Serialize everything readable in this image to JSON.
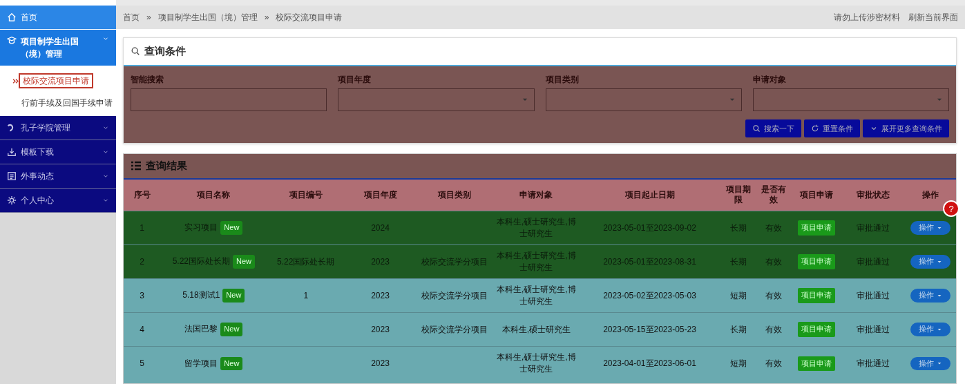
{
  "sidebar": {
    "items": [
      {
        "label": "首页",
        "selected": true
      },
      {
        "label": "项目制学生出国（境）管理",
        "selected": false,
        "expanded": true,
        "children": [
          {
            "label": "校际交流项目申请",
            "selected": true
          },
          {
            "label": "行前手续及回国手续申请",
            "selected": false
          }
        ]
      },
      {
        "label": "孔子学院管理",
        "selected": false,
        "expanded": false
      },
      {
        "label": "模板下载",
        "selected": false,
        "expanded": false
      },
      {
        "label": "外事动态",
        "selected": false,
        "expanded": false
      },
      {
        "label": "个人中心",
        "selected": false,
        "expanded": false
      }
    ]
  },
  "breadcrumb": {
    "items": [
      "首页",
      "项目制学生出国（境）管理",
      "校际交流项目申请"
    ],
    "separator": "»"
  },
  "header_links": [
    "请勿上传涉密材料",
    "刷新当前界面"
  ],
  "filters": {
    "title": "查询条件",
    "fields": [
      {
        "label": "智能搜索",
        "kind": "text"
      },
      {
        "label": "项目年度",
        "kind": "select"
      },
      {
        "label": "项目类别",
        "kind": "select"
      },
      {
        "label": "申请对象",
        "kind": "select"
      }
    ],
    "buttons": [
      {
        "label": "搜索一下",
        "kind": "search"
      },
      {
        "label": "重置条件",
        "kind": "reset"
      },
      {
        "label": "展开更多查询条件",
        "kind": "expand"
      }
    ]
  },
  "results": {
    "title": "查询结果",
    "columns": [
      "序号",
      "项目名称",
      "项目编号",
      "项目年度",
      "项目类别",
      "申请对象",
      "项目起止日期",
      "项目期限",
      "是否有效",
      "项目申请",
      "审批状态",
      "操作"
    ],
    "rows": [
      {
        "index": "1",
        "name": "实习项目",
        "badge": "New",
        "year": "2024",
        "target": "本科生,硕士研究生,博士研究生",
        "dates": "2023-05-01至2023-09-02",
        "term": "长期",
        "valid": "有效",
        "apply": "项目申请",
        "status": "审批通过",
        "action": "操作"
      },
      {
        "index": "2",
        "name": "5.22国际处长期",
        "badge": "New",
        "code": "5.22国际处长期",
        "year": "2023",
        "category": "校际交流学分项目",
        "target": "本科生,硕士研究生,博士研究生",
        "dates": "2023-05-01至2023-08-31",
        "term": "长期",
        "valid": "有效",
        "apply": "项目申请",
        "status": "审批通过",
        "action": "操作"
      },
      {
        "index": "3",
        "name": "5.18测试1",
        "badge": "New",
        "code": "1",
        "year": "2023",
        "category": "校际交流学分项目",
        "target": "本科生,硕士研究生,博士研究生",
        "dates": "2023-05-02至2023-05-03",
        "term": "短期",
        "valid": "有效",
        "apply": "项目申请",
        "status": "审批通过",
        "action": "操作"
      },
      {
        "index": "4",
        "name": "法国巴黎",
        "badge": "New",
        "year": "2023",
        "category": "校际交流学分项目",
        "target": "本科生,硕士研究生",
        "dates": "2023-05-15至2023-05-23",
        "term": "长期",
        "valid": "有效",
        "apply": "项目申请",
        "status": "审批通过",
        "action": "操作"
      },
      {
        "index": "5",
        "name": "留学项目",
        "badge": "New",
        "year": "2023",
        "target": "本科生,硕士研究生,博士研究生",
        "dates": "2023-04-01至2023-06-01",
        "term": "短期",
        "valid": "有效",
        "apply": "项目申请",
        "status": "审批通过",
        "action": "操作"
      }
    ]
  },
  "help_button": "?"
}
